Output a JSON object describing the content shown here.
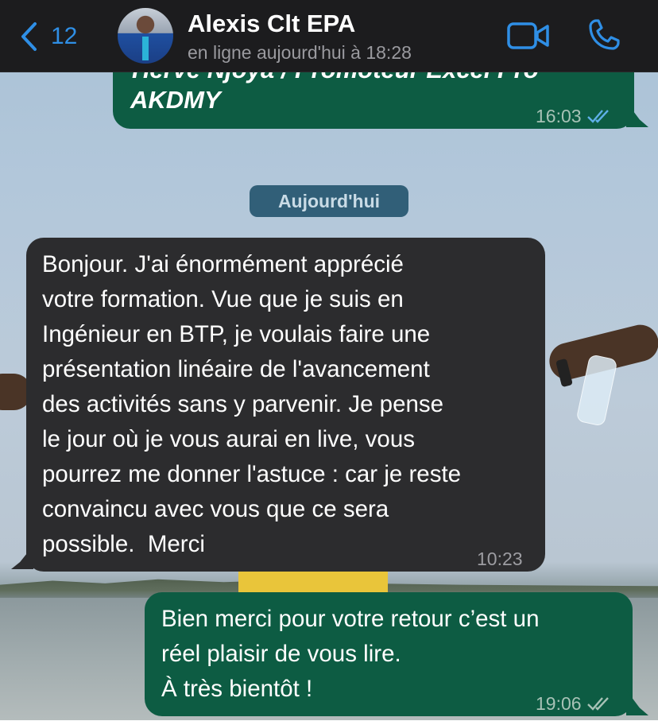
{
  "header": {
    "back_count": "12",
    "contact_name": "Alexis Clt EPA",
    "status": "en ligne aujourd'hui à 18:28",
    "icons": {
      "back": "chevron-left-icon",
      "video": "video-camera-icon",
      "call": "phone-icon"
    },
    "accent_color": "#2f8fe6"
  },
  "messages": {
    "top_partial": "Hervé Njoya / Promoteur Excel Pro",
    "top_last_line": "AKDMY",
    "top_time": "16:03",
    "date_separator": "Aujourd'hui",
    "incoming_text": "Bonjour. J'ai énormément apprécié\nvotre formation. Vue que je suis en\nIngénieur en BTP, je voulais faire une\nprésentation linéaire de l'avancement\ndes activités sans y parvenir. Je pense\nle jour où je vous aurai en live, vous\npourrez me donner l'astuce : car je reste\nconvaincu avec vous que ce sera\npossible.  Merci",
    "incoming_time": "10:23",
    "outgoing_text": "Bien merci pour votre retour c’est un\nréel plaisir de vous lire.\nÀ très bientôt !",
    "outgoing_time": "19:06"
  },
  "colors": {
    "outgoing_bubble": "#0d5c43",
    "incoming_bubble": "#2c2c2e",
    "read_ticks": "#5fb0e8",
    "delivered_ticks": "#a7c2b6"
  }
}
